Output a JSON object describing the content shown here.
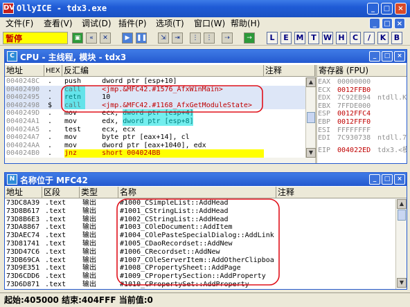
{
  "window": {
    "title": "OllyICE - tdx3.exe",
    "icon_text": "DV",
    "min": "_",
    "max": "□",
    "close": "×"
  },
  "menu": [
    "文件(F)",
    "查看(V)",
    "调试(D)",
    "插件(P)",
    "选项(T)",
    "窗口(W)",
    "帮助(H)"
  ],
  "toolbar": {
    "state": "暂停",
    "letters": [
      "L",
      "E",
      "M",
      "T",
      "W",
      "H",
      "C",
      "/",
      "K",
      "B"
    ]
  },
  "cpu": {
    "title": "CPU - 主线程, 模块 - tdx3",
    "icon": "C",
    "headers": {
      "address": "地址",
      "hex": "HEX",
      "disasm": "反汇编",
      "comment": "注释",
      "registers": "寄存器 (FPU)"
    },
    "rows": [
      {
        "addr": "0040248C",
        "hex": ".",
        "asm": "push     dword ptr [esp+10]"
      },
      {
        "addr": "00402490",
        "hex": ".",
        "asm": "call     <jmp.&MFC42.#1576_AfxWinMain>"
      },
      {
        "addr": "00402495",
        "hex": ".",
        "asm": "retn     10"
      },
      {
        "addr": "00402498",
        "hex": "$",
        "asm": "call     <jmp.&MFC42.#1168_AfxGetModuleState>"
      },
      {
        "addr": "0040249D",
        "hex": ".",
        "asm": "mov      ecx, dword ptr [esp+4]"
      },
      {
        "addr": "004024A1",
        "hex": ".",
        "asm": "mov      edx, dword ptr [esp+8]"
      },
      {
        "addr": "004024A5",
        "hex": ".",
        "asm": "test     ecx, ecx"
      },
      {
        "addr": "004024A7",
        "hex": ".",
        "asm": "mov      byte ptr [eax+14], cl"
      },
      {
        "addr": "004024AA",
        "hex": ".",
        "asm": "mov      dword ptr [eax+1040], edx"
      },
      {
        "addr": "004024B0",
        "hex": ".",
        "asm": "jnz      short 004024BB"
      }
    ],
    "registers": [
      {
        "name": "EAX",
        "value": "00000000",
        "extra": ""
      },
      {
        "name": "ECX",
        "value": "0012FFB0",
        "extra": ""
      },
      {
        "name": "EDX",
        "value": "7C92EB94",
        "extra": "ntdll.K"
      },
      {
        "name": "EBX",
        "value": "7FFDE000",
        "extra": ""
      },
      {
        "name": "ESP",
        "value": "0012FFC4",
        "extra": ""
      },
      {
        "name": "EBP",
        "value": "0012FFF0",
        "extra": ""
      },
      {
        "name": "ESI",
        "value": "FFFFFFFF",
        "extra": ""
      },
      {
        "name": "EDI",
        "value": "7C930738",
        "extra": "ntdll.7"
      },
      {
        "name": "EIP",
        "value": "004022ED",
        "extra": "tdx3.<模"
      }
    ]
  },
  "names": {
    "title": "名称位于 MFC42",
    "icon": "N",
    "headers": {
      "address": "地址",
      "section": "区段",
      "type": "类型",
      "name": "名称",
      "comment": "注释"
    },
    "rows": [
      {
        "addr": "73DC8A39",
        "section": ".text",
        "type": "输出",
        "name": "#1000_CSimpleList::AddHead"
      },
      {
        "addr": "73D8B617",
        "section": ".text",
        "type": "输出",
        "name": "#1001_CStringList::AddHead"
      },
      {
        "addr": "73D8B6E3",
        "section": ".text",
        "type": "输出",
        "name": "#1002_CStringList::AddHead"
      },
      {
        "addr": "73DA8867",
        "section": ".text",
        "type": "输出",
        "name": "#1003_COleDocument::AddItem"
      },
      {
        "addr": "73DAEC74",
        "section": ".text",
        "type": "输出",
        "name": "#1004_COlePasteSpecialDialog::AddLink"
      },
      {
        "addr": "73D81741",
        "section": ".text",
        "type": "输出",
        "name": "#1005_CDaoRecordset::AddNew"
      },
      {
        "addr": "73DD47C6",
        "section": ".text",
        "type": "输出",
        "name": "#1006_CRecordset::AddNew"
      },
      {
        "addr": "73DB69CA",
        "section": ".text",
        "type": "输出",
        "name": "#1007_COleServerItem::AddOtherClipboa"
      },
      {
        "addr": "73D9E351",
        "section": ".text",
        "type": "输出",
        "name": "#1008_CPropertySheet::AddPage"
      },
      {
        "addr": "73D6CDD6",
        "section": ".text",
        "type": "输出",
        "name": "#1009_CPropertySection::AddProperty"
      },
      {
        "addr": "73D6D871",
        "section": ".text",
        "type": "输出",
        "name": "#1010_CPropertySet::AddProperty"
      }
    ]
  },
  "status": "起始:405000 结束:404FFF 当前值:0",
  "colors": {
    "accent": "#1f5bd6",
    "highlight_cyan": "#00e0e0",
    "annotation": "#e0101a",
    "reg_red": "#c00000"
  }
}
